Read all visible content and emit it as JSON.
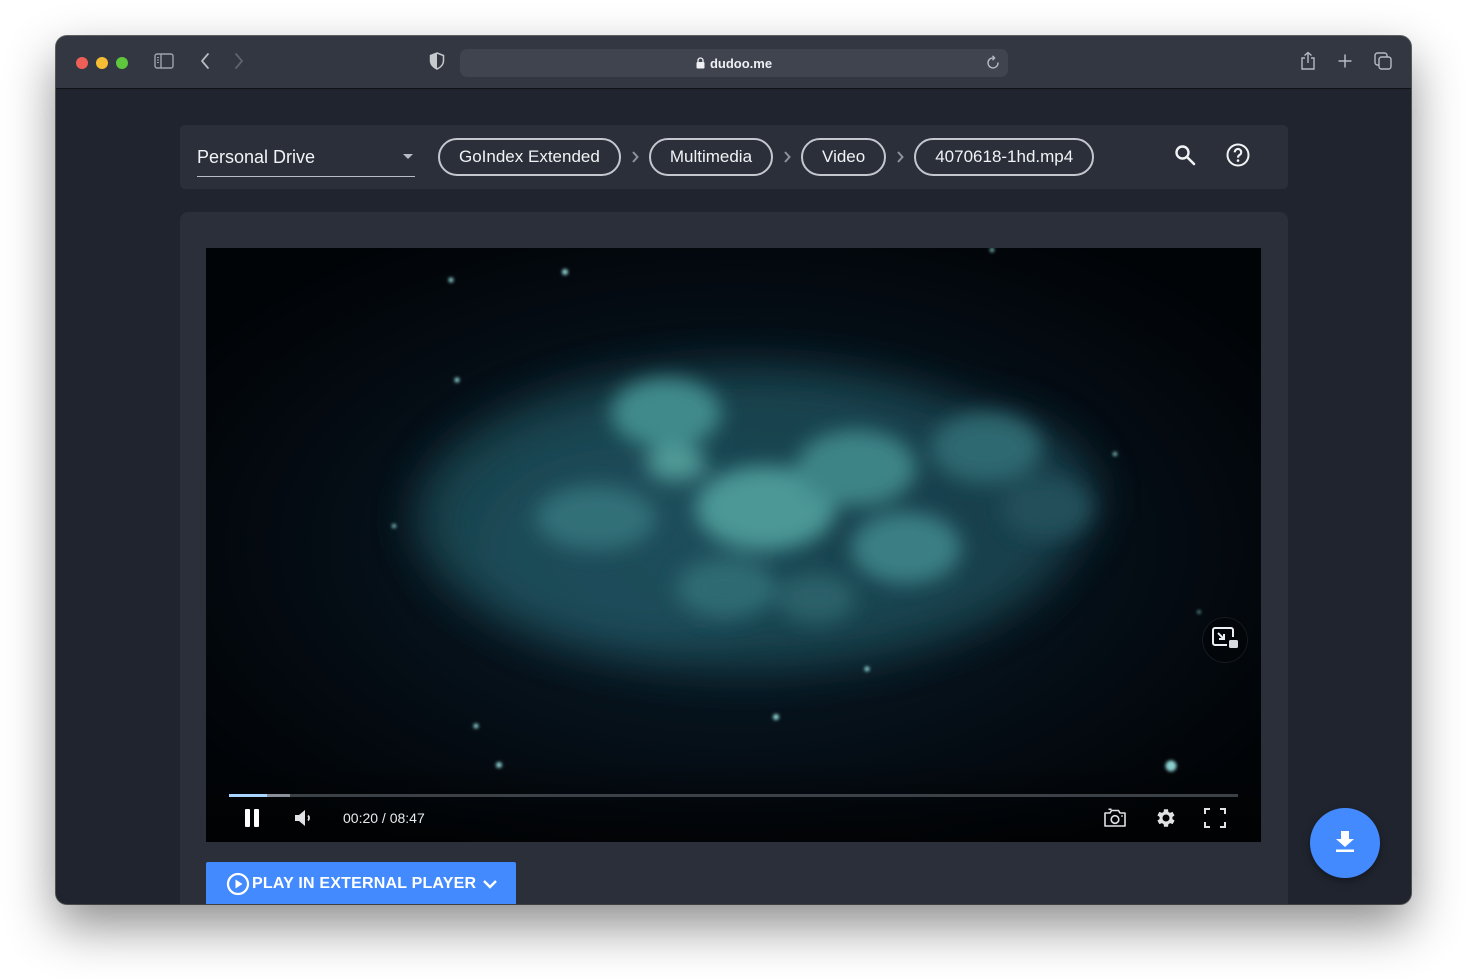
{
  "browser": {
    "url": "dudoo.me",
    "icons": {
      "sidebar": "sidebar-toggle-icon",
      "back": "chevron-left-icon",
      "forward": "chevron-right-icon",
      "privacy": "shield-icon",
      "lock": "lock-icon",
      "reload": "reload-icon",
      "share": "share-icon",
      "new_tab": "plus-icon",
      "tabs": "tab-overview-icon"
    }
  },
  "navbar": {
    "drive_select": {
      "value": "Personal Drive"
    },
    "breadcrumbs": [
      {
        "label": "GoIndex Extended"
      },
      {
        "label": "Multimedia"
      },
      {
        "label": "Video"
      },
      {
        "label": "4070618-1hd.mp4"
      }
    ],
    "icons": {
      "search": "search-icon",
      "help": "help-circle-icon"
    }
  },
  "player": {
    "current_time": "00:20",
    "duration": "08:47",
    "time_display": "00:20 / 08:47",
    "progress_played_fraction": 0.038,
    "progress_buffered_fraction": 0.06,
    "state": "playing",
    "icons": {
      "pause": "pause-icon",
      "volume": "volume-icon",
      "screenshot": "camera-icon",
      "settings": "gear-icon",
      "fullscreen": "fullscreen-icon",
      "pip": "picture-in-picture-icon"
    }
  },
  "actions": {
    "external_player_label": "PLAY IN EXTERNAL PLAYER",
    "download_icon": "download-icon"
  },
  "colors": {
    "accent": "#448aff",
    "page_bg": "#1f242e",
    "card_bg": "#2a2f39",
    "progress_played": "#a9d4ff"
  }
}
